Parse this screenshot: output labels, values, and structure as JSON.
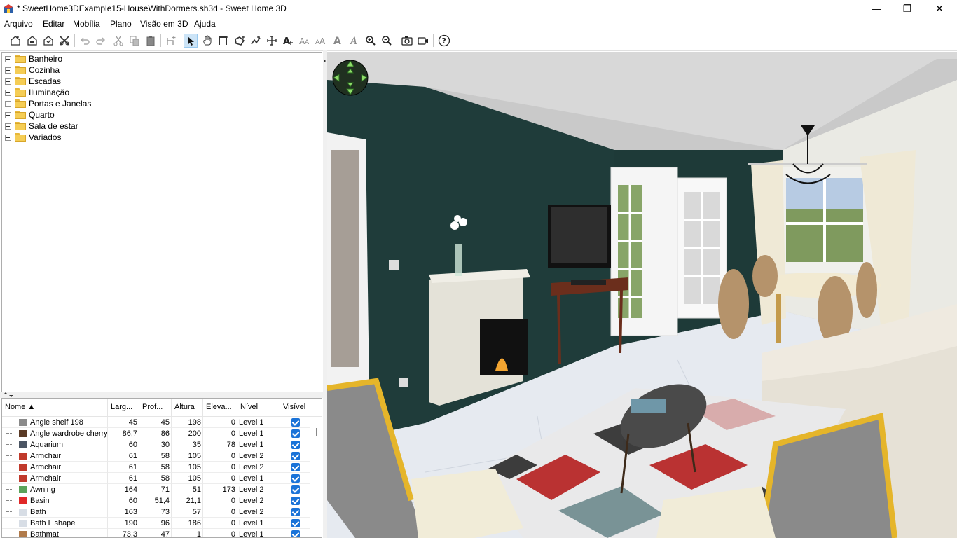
{
  "window": {
    "title": "* SweetHome3DExample15-HouseWithDormers.sh3d - Sweet Home 3D",
    "minimize": "—",
    "maximize": "❐",
    "close": "✕"
  },
  "menu": [
    "Arquivo",
    "Editar",
    "Mobília",
    "Plano",
    "Visão em 3D",
    "Ajuda"
  ],
  "toolbar": {
    "icons": [
      "new-home-icon",
      "open-icon",
      "save-icon",
      "preferences-icon",
      "undo-icon",
      "redo-icon",
      "cut-icon",
      "copy-icon",
      "paste-icon",
      "add-furniture-icon",
      "select-mode-icon",
      "pan-mode-icon",
      "create-walls-icon",
      "create-rooms-icon",
      "create-polylines-icon",
      "create-dimensions-icon",
      "add-text-icon",
      "increase-text-size-icon",
      "decrease-text-size-icon",
      "bold-text-icon",
      "italic-text-icon",
      "zoom-in-icon",
      "zoom-out-icon",
      "create-photo-icon",
      "create-video-icon",
      "help-icon"
    ],
    "selected": "select-mode-icon"
  },
  "catalog": {
    "categories": [
      "Banheiro",
      "Cozinha",
      "Escadas",
      "Iluminação",
      "Portas e Janelas",
      "Quarto",
      "Sala de estar",
      "Variados"
    ]
  },
  "furniture_table": {
    "columns": [
      "Nome ▲",
      "Larg...",
      "Prof...",
      "Altura",
      "Eleva...",
      "Nível",
      "Visível"
    ],
    "rows": [
      {
        "name": "Angle shelf 198",
        "w": "45",
        "d": "45",
        "h": "198",
        "e": "0",
        "level": "Level 1",
        "visible": true,
        "icon": "shelf-icon"
      },
      {
        "name": "Angle wardrobe cherry",
        "w": "86,7",
        "d": "86",
        "h": "200",
        "e": "0",
        "level": "Level 1",
        "visible": true,
        "icon": "wardrobe-icon"
      },
      {
        "name": "Aquarium",
        "w": "60",
        "d": "30",
        "h": "35",
        "e": "78",
        "level": "Level 1",
        "visible": true,
        "icon": "aquarium-icon"
      },
      {
        "name": "Armchair",
        "w": "61",
        "d": "58",
        "h": "105",
        "e": "0",
        "level": "Level 2",
        "visible": true,
        "icon": "armchair-icon"
      },
      {
        "name": "Armchair",
        "w": "61",
        "d": "58",
        "h": "105",
        "e": "0",
        "level": "Level 2",
        "visible": true,
        "icon": "armchair-icon"
      },
      {
        "name": "Armchair",
        "w": "61",
        "d": "58",
        "h": "105",
        "e": "0",
        "level": "Level 1",
        "visible": true,
        "icon": "armchair-icon"
      },
      {
        "name": "Awning",
        "w": "164",
        "d": "71",
        "h": "51",
        "e": "173",
        "level": "Level 2",
        "visible": true,
        "icon": "awning-icon"
      },
      {
        "name": "Basin",
        "w": "60",
        "d": "51,4",
        "h": "21,1",
        "e": "0",
        "level": "Level 2",
        "visible": true,
        "icon": "basin-icon"
      },
      {
        "name": "Bath",
        "w": "163",
        "d": "73",
        "h": "57",
        "e": "0",
        "level": "Level 2",
        "visible": true,
        "icon": "bath-icon"
      },
      {
        "name": "Bath L shape",
        "w": "190",
        "d": "96",
        "h": "186",
        "e": "0",
        "level": "Level 1",
        "visible": true,
        "icon": "bath-icon"
      },
      {
        "name": "Bathmat",
        "w": "73,3",
        "d": "47",
        "h": "1",
        "e": "0",
        "level": "Level 1",
        "visible": true,
        "icon": "bathmat-icon"
      }
    ]
  },
  "colors": {
    "wall": "#1f3c3a",
    "ceiling": "#dcdcdc",
    "floor": "#e8ecf2",
    "accent": "#1a73d8"
  }
}
